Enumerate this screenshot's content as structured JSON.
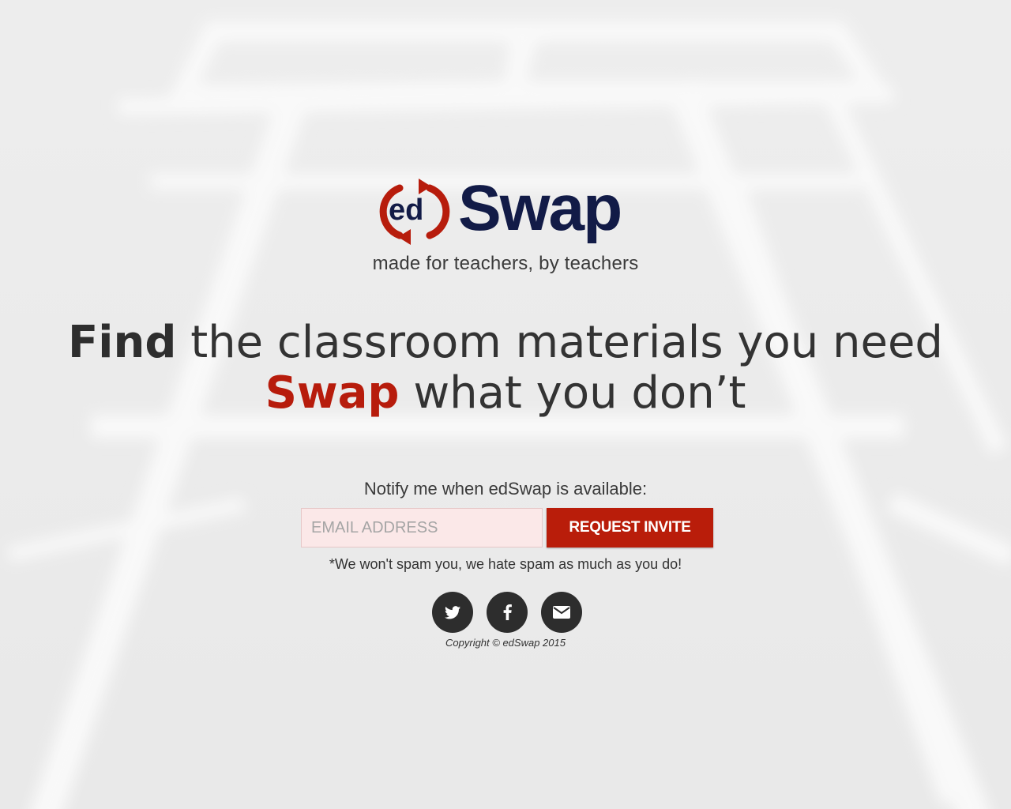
{
  "brand": {
    "logo_ed": "ed",
    "logo_name": "Swap",
    "tagline": "made for teachers, by teachers",
    "navy": "#121b47",
    "red": "#b71c0c"
  },
  "headline": {
    "line1_bold": "Find",
    "line1_rest": " the classroom materials you need",
    "line2_bold": "Swap",
    "line2_rest": " what you don’t"
  },
  "signup": {
    "label": "Notify me when edSwap is available:",
    "email_placeholder": "EMAIL ADDRESS",
    "email_value": "",
    "button_label": "REQUEST INVITE",
    "spam_note": "*We won't spam you, we hate spam as much as you do!"
  },
  "social": [
    {
      "name": "twitter",
      "icon": "twitter-icon"
    },
    {
      "name": "facebook",
      "icon": "facebook-icon"
    },
    {
      "name": "email",
      "icon": "envelope-icon"
    }
  ],
  "footer": {
    "copyright": "Copyright © edSwap 2015"
  }
}
